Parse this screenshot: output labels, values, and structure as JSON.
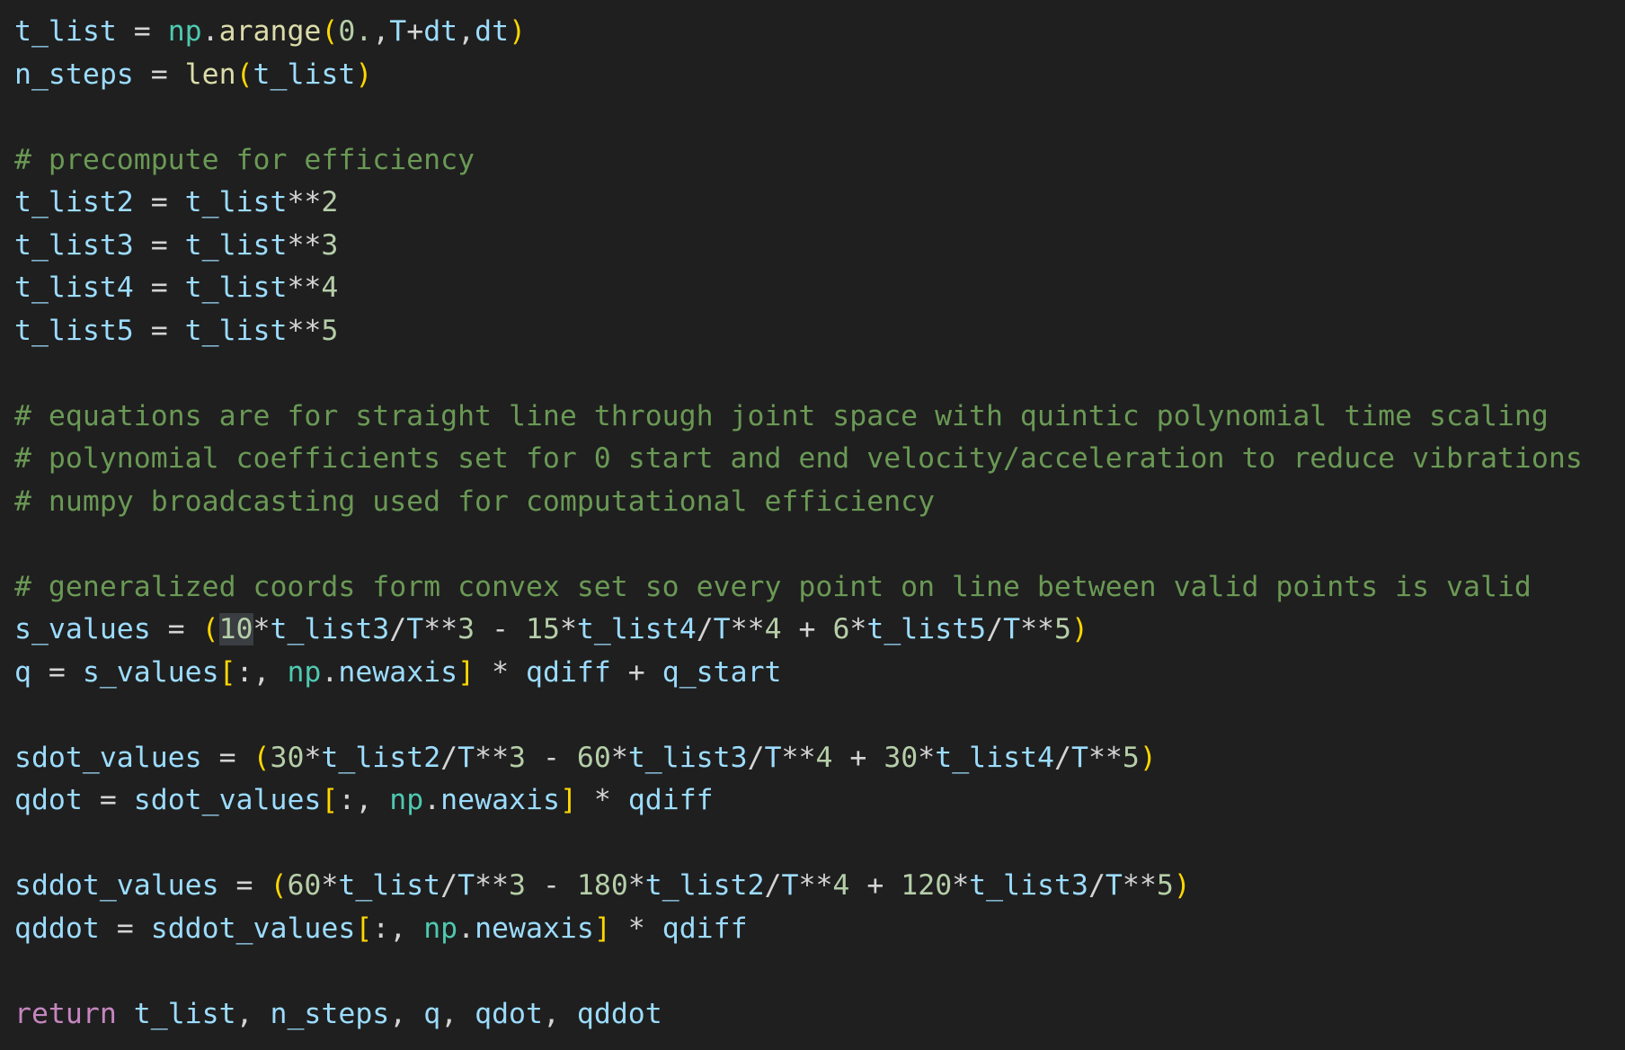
{
  "code": [
    [
      {
        "t": "t_list",
        "c": "var"
      },
      {
        "t": " = ",
        "c": "op"
      },
      {
        "t": "np",
        "c": "mod"
      },
      {
        "t": ".",
        "c": "op"
      },
      {
        "t": "arange",
        "c": "fn"
      },
      {
        "t": "(",
        "c": "paren"
      },
      {
        "t": "0.",
        "c": "num"
      },
      {
        "t": ",",
        "c": "op"
      },
      {
        "t": "T",
        "c": "var"
      },
      {
        "t": "+",
        "c": "op"
      },
      {
        "t": "dt",
        "c": "var"
      },
      {
        "t": ",",
        "c": "op"
      },
      {
        "t": "dt",
        "c": "var"
      },
      {
        "t": ")",
        "c": "paren"
      }
    ],
    [
      {
        "t": "n_steps",
        "c": "var"
      },
      {
        "t": " = ",
        "c": "op"
      },
      {
        "t": "len",
        "c": "fn"
      },
      {
        "t": "(",
        "c": "paren"
      },
      {
        "t": "t_list",
        "c": "var"
      },
      {
        "t": ")",
        "c": "paren"
      }
    ],
    [],
    [
      {
        "t": "# precompute for efficiency",
        "c": "comment"
      }
    ],
    [
      {
        "t": "t_list2",
        "c": "var"
      },
      {
        "t": " = ",
        "c": "op"
      },
      {
        "t": "t_list",
        "c": "var"
      },
      {
        "t": "**",
        "c": "op"
      },
      {
        "t": "2",
        "c": "num"
      }
    ],
    [
      {
        "t": "t_list3",
        "c": "var"
      },
      {
        "t": " = ",
        "c": "op"
      },
      {
        "t": "t_list",
        "c": "var"
      },
      {
        "t": "**",
        "c": "op"
      },
      {
        "t": "3",
        "c": "num"
      }
    ],
    [
      {
        "t": "t_list4",
        "c": "var"
      },
      {
        "t": " = ",
        "c": "op"
      },
      {
        "t": "t_list",
        "c": "var"
      },
      {
        "t": "**",
        "c": "op"
      },
      {
        "t": "4",
        "c": "num"
      }
    ],
    [
      {
        "t": "t_list5",
        "c": "var"
      },
      {
        "t": " = ",
        "c": "op"
      },
      {
        "t": "t_list",
        "c": "var"
      },
      {
        "t": "**",
        "c": "op"
      },
      {
        "t": "5",
        "c": "num"
      }
    ],
    [],
    [
      {
        "t": "# equations are for straight line through joint space with quintic polynomial time scaling",
        "c": "comment"
      }
    ],
    [
      {
        "t": "# polynomial coefficients set for 0 start and end velocity/acceleration to reduce vibrations",
        "c": "comment"
      }
    ],
    [
      {
        "t": "# numpy broadcasting used for computational efficiency",
        "c": "comment"
      }
    ],
    [],
    [
      {
        "t": "# generalized coords form convex set so every point on line between valid points is valid",
        "c": "comment"
      }
    ],
    [
      {
        "t": "s_values",
        "c": "var"
      },
      {
        "t": " = ",
        "c": "op"
      },
      {
        "t": "(",
        "c": "paren"
      },
      {
        "t": "10",
        "c": "num",
        "hl": true
      },
      {
        "t": "*",
        "c": "op"
      },
      {
        "t": "t_list3",
        "c": "var"
      },
      {
        "t": "/",
        "c": "op"
      },
      {
        "t": "T",
        "c": "var"
      },
      {
        "t": "**",
        "c": "op"
      },
      {
        "t": "3",
        "c": "num"
      },
      {
        "t": " - ",
        "c": "op"
      },
      {
        "t": "15",
        "c": "num"
      },
      {
        "t": "*",
        "c": "op"
      },
      {
        "t": "t_list4",
        "c": "var"
      },
      {
        "t": "/",
        "c": "op"
      },
      {
        "t": "T",
        "c": "var"
      },
      {
        "t": "**",
        "c": "op"
      },
      {
        "t": "4",
        "c": "num"
      },
      {
        "t": " + ",
        "c": "op"
      },
      {
        "t": "6",
        "c": "num"
      },
      {
        "t": "*",
        "c": "op"
      },
      {
        "t": "t_list5",
        "c": "var"
      },
      {
        "t": "/",
        "c": "op"
      },
      {
        "t": "T",
        "c": "var"
      },
      {
        "t": "**",
        "c": "op"
      },
      {
        "t": "5",
        "c": "num"
      },
      {
        "t": ")",
        "c": "paren"
      }
    ],
    [
      {
        "t": "q",
        "c": "var"
      },
      {
        "t": " = ",
        "c": "op"
      },
      {
        "t": "s_values",
        "c": "var"
      },
      {
        "t": "[",
        "c": "paren"
      },
      {
        "t": ":, ",
        "c": "op"
      },
      {
        "t": "np",
        "c": "mod"
      },
      {
        "t": ".",
        "c": "op"
      },
      {
        "t": "newaxis",
        "c": "var"
      },
      {
        "t": "]",
        "c": "paren"
      },
      {
        "t": " * ",
        "c": "op"
      },
      {
        "t": "qdiff",
        "c": "var"
      },
      {
        "t": " + ",
        "c": "op"
      },
      {
        "t": "q_start",
        "c": "var"
      }
    ],
    [],
    [
      {
        "t": "sdot_values",
        "c": "var"
      },
      {
        "t": " = ",
        "c": "op"
      },
      {
        "t": "(",
        "c": "paren"
      },
      {
        "t": "30",
        "c": "num"
      },
      {
        "t": "*",
        "c": "op"
      },
      {
        "t": "t_list2",
        "c": "var"
      },
      {
        "t": "/",
        "c": "op"
      },
      {
        "t": "T",
        "c": "var"
      },
      {
        "t": "**",
        "c": "op"
      },
      {
        "t": "3",
        "c": "num"
      },
      {
        "t": " - ",
        "c": "op"
      },
      {
        "t": "60",
        "c": "num"
      },
      {
        "t": "*",
        "c": "op"
      },
      {
        "t": "t_list3",
        "c": "var"
      },
      {
        "t": "/",
        "c": "op"
      },
      {
        "t": "T",
        "c": "var"
      },
      {
        "t": "**",
        "c": "op"
      },
      {
        "t": "4",
        "c": "num"
      },
      {
        "t": " + ",
        "c": "op"
      },
      {
        "t": "30",
        "c": "num"
      },
      {
        "t": "*",
        "c": "op"
      },
      {
        "t": "t_list4",
        "c": "var"
      },
      {
        "t": "/",
        "c": "op"
      },
      {
        "t": "T",
        "c": "var"
      },
      {
        "t": "**",
        "c": "op"
      },
      {
        "t": "5",
        "c": "num"
      },
      {
        "t": ")",
        "c": "paren"
      }
    ],
    [
      {
        "t": "qdot",
        "c": "var"
      },
      {
        "t": " = ",
        "c": "op"
      },
      {
        "t": "sdot_values",
        "c": "var"
      },
      {
        "t": "[",
        "c": "paren"
      },
      {
        "t": ":, ",
        "c": "op"
      },
      {
        "t": "np",
        "c": "mod"
      },
      {
        "t": ".",
        "c": "op"
      },
      {
        "t": "newaxis",
        "c": "var"
      },
      {
        "t": "]",
        "c": "paren"
      },
      {
        "t": " * ",
        "c": "op"
      },
      {
        "t": "qdiff",
        "c": "var"
      }
    ],
    [],
    [
      {
        "t": "sddot_values",
        "c": "var"
      },
      {
        "t": " = ",
        "c": "op"
      },
      {
        "t": "(",
        "c": "paren"
      },
      {
        "t": "60",
        "c": "num"
      },
      {
        "t": "*",
        "c": "op"
      },
      {
        "t": "t_list",
        "c": "var"
      },
      {
        "t": "/",
        "c": "op"
      },
      {
        "t": "T",
        "c": "var"
      },
      {
        "t": "**",
        "c": "op"
      },
      {
        "t": "3",
        "c": "num"
      },
      {
        "t": " - ",
        "c": "op"
      },
      {
        "t": "180",
        "c": "num"
      },
      {
        "t": "*",
        "c": "op"
      },
      {
        "t": "t_list2",
        "c": "var"
      },
      {
        "t": "/",
        "c": "op"
      },
      {
        "t": "T",
        "c": "var"
      },
      {
        "t": "**",
        "c": "op"
      },
      {
        "t": "4",
        "c": "num"
      },
      {
        "t": " + ",
        "c": "op"
      },
      {
        "t": "120",
        "c": "num"
      },
      {
        "t": "*",
        "c": "op"
      },
      {
        "t": "t_list3",
        "c": "var"
      },
      {
        "t": "/",
        "c": "op"
      },
      {
        "t": "T",
        "c": "var"
      },
      {
        "t": "**",
        "c": "op"
      },
      {
        "t": "5",
        "c": "num"
      },
      {
        "t": ")",
        "c": "paren"
      }
    ],
    [
      {
        "t": "qddot",
        "c": "var"
      },
      {
        "t": " = ",
        "c": "op"
      },
      {
        "t": "sddot_values",
        "c": "var"
      },
      {
        "t": "[",
        "c": "paren"
      },
      {
        "t": ":, ",
        "c": "op"
      },
      {
        "t": "np",
        "c": "mod"
      },
      {
        "t": ".",
        "c": "op"
      },
      {
        "t": "newaxis",
        "c": "var"
      },
      {
        "t": "]",
        "c": "paren"
      },
      {
        "t": " * ",
        "c": "op"
      },
      {
        "t": "qdiff",
        "c": "var"
      }
    ],
    [],
    [
      {
        "t": "return",
        "c": "kw"
      },
      {
        "t": " ",
        "c": "op"
      },
      {
        "t": "t_list",
        "c": "var"
      },
      {
        "t": ", ",
        "c": "op"
      },
      {
        "t": "n_steps",
        "c": "var"
      },
      {
        "t": ", ",
        "c": "op"
      },
      {
        "t": "q",
        "c": "var"
      },
      {
        "t": ", ",
        "c": "op"
      },
      {
        "t": "qdot",
        "c": "var"
      },
      {
        "t": ", ",
        "c": "op"
      },
      {
        "t": "qddot",
        "c": "var"
      }
    ]
  ]
}
